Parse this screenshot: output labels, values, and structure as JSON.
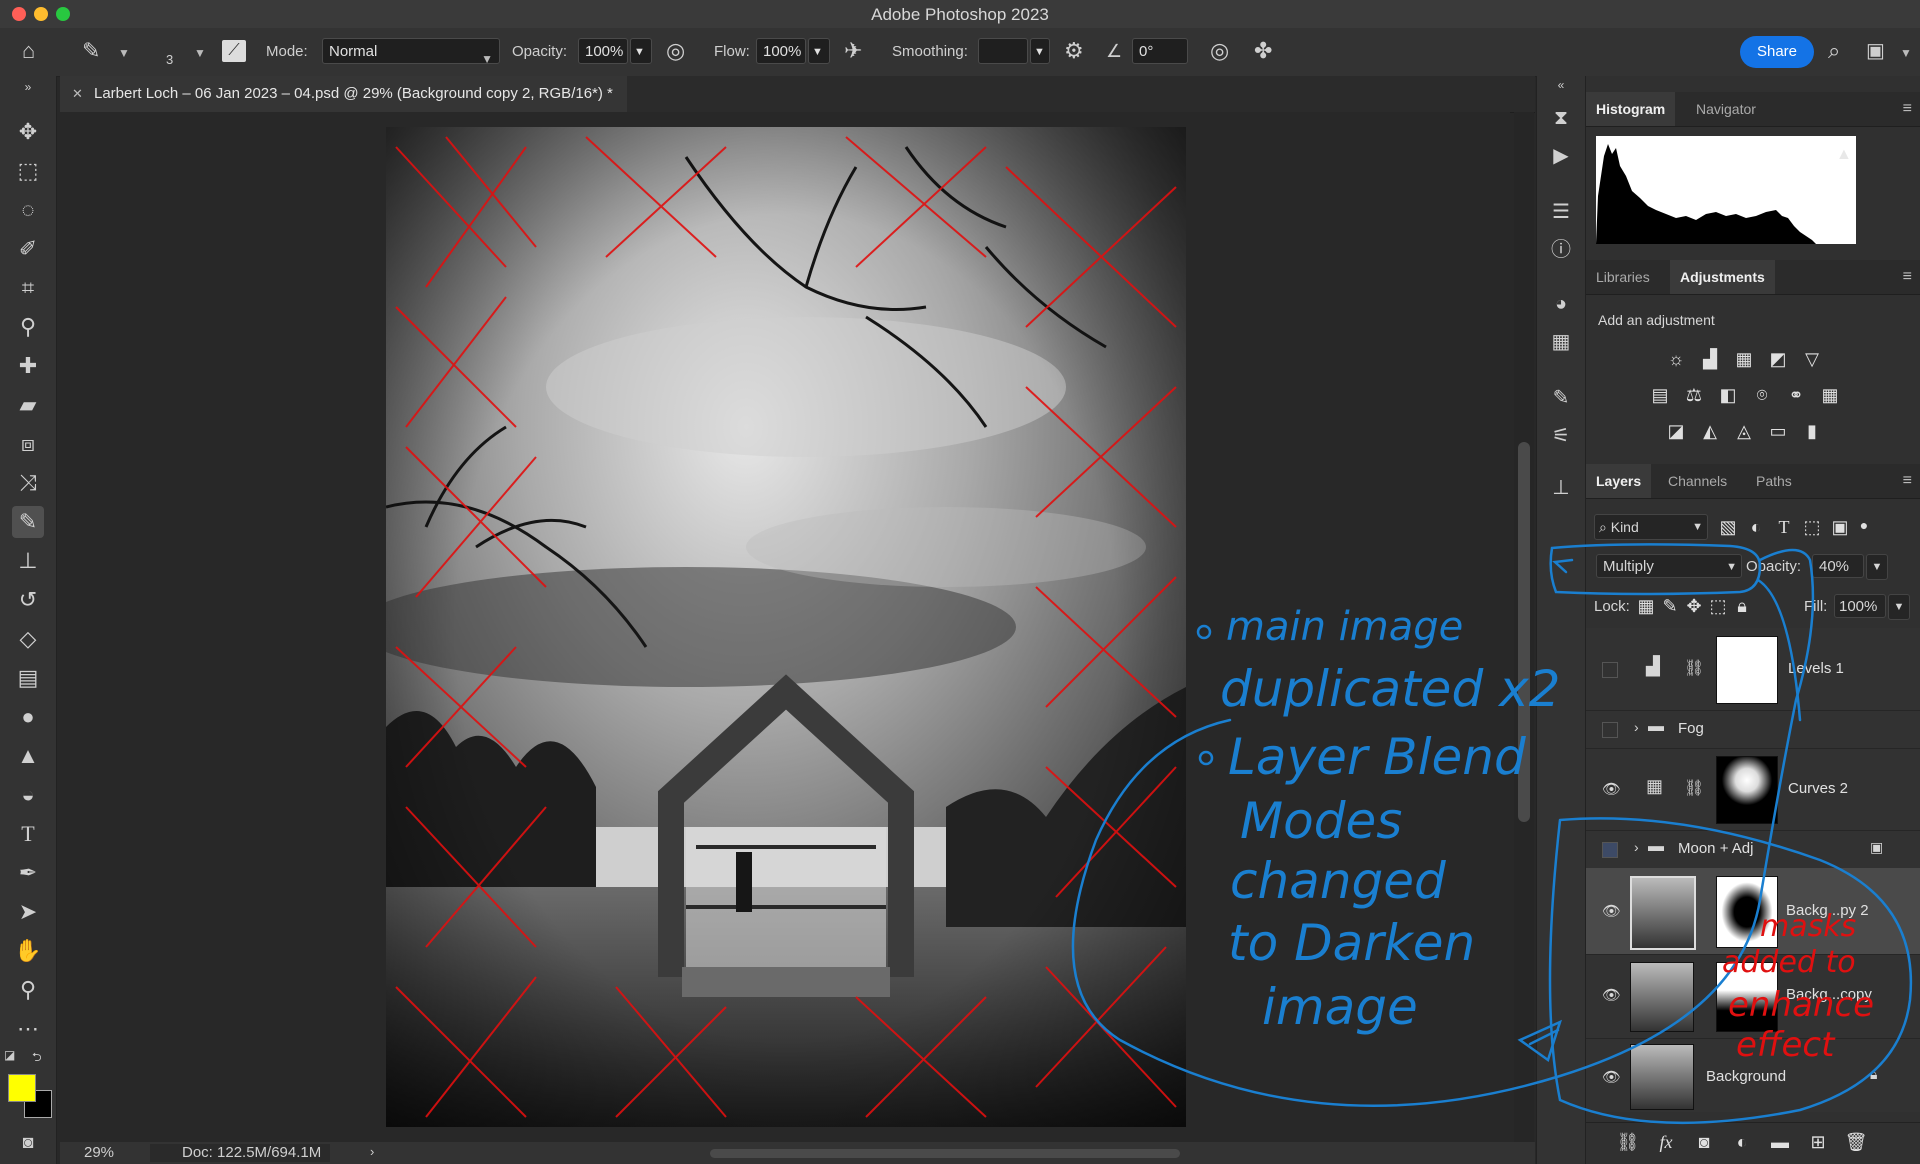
{
  "window": {
    "title": "Adobe Photoshop 2023"
  },
  "options": {
    "brush_size": "3",
    "mode_label": "Mode:",
    "mode_value": "Normal",
    "opacity_label": "Opacity:",
    "opacity_value": "100%",
    "flow_label": "Flow:",
    "flow_value": "100%",
    "smoothing_label": "Smoothing:",
    "smoothing_value": "",
    "angle_value": "0°",
    "share_label": "Share"
  },
  "document": {
    "tab_title": "Larbert Loch – 06 Jan 2023 – 04.psd @ 29% (Background copy 2, RGB/16*) *"
  },
  "status": {
    "zoom": "29%",
    "doc_size": "Doc: 122.5M/694.1M"
  },
  "panels": {
    "histogram_tabs": [
      "Histogram",
      "Navigator"
    ],
    "adjust_tabs": [
      "Libraries",
      "Adjustments"
    ],
    "add_adjustment": "Add an adjustment",
    "layer_tabs": [
      "Layers",
      "Channels",
      "Paths"
    ],
    "filter_kind": "Kind",
    "blend_mode": "Multiply",
    "opacity_label": "Opacity:",
    "opacity_value": "40%",
    "lock_label": "Lock:",
    "fill_label": "Fill:",
    "fill_value": "100%"
  },
  "layers": [
    {
      "name": "Levels 1",
      "visible": false
    },
    {
      "name": "Fog",
      "visible": false,
      "group": true
    },
    {
      "name": "Curves 2",
      "visible": true
    },
    {
      "name": "Moon + Adj",
      "visible": false,
      "group": true
    },
    {
      "name": "Backg...py 2",
      "visible": true
    },
    {
      "name": "Backg...copy",
      "visible": true
    },
    {
      "name": "Background",
      "visible": true
    }
  ],
  "annotations": {
    "blue_lines": [
      "main image",
      "duplicated x2",
      "Layer Blend",
      "Modes",
      "changed",
      "to Darken",
      "image"
    ],
    "red_lines": [
      "masks",
      "added to",
      "enhance",
      "effect"
    ]
  },
  "colors": {
    "foreground": "#ffff00",
    "background": "#000000",
    "accent": "#1473e6",
    "annotation_blue": "#1a7fd0",
    "annotation_red": "#e01010"
  }
}
